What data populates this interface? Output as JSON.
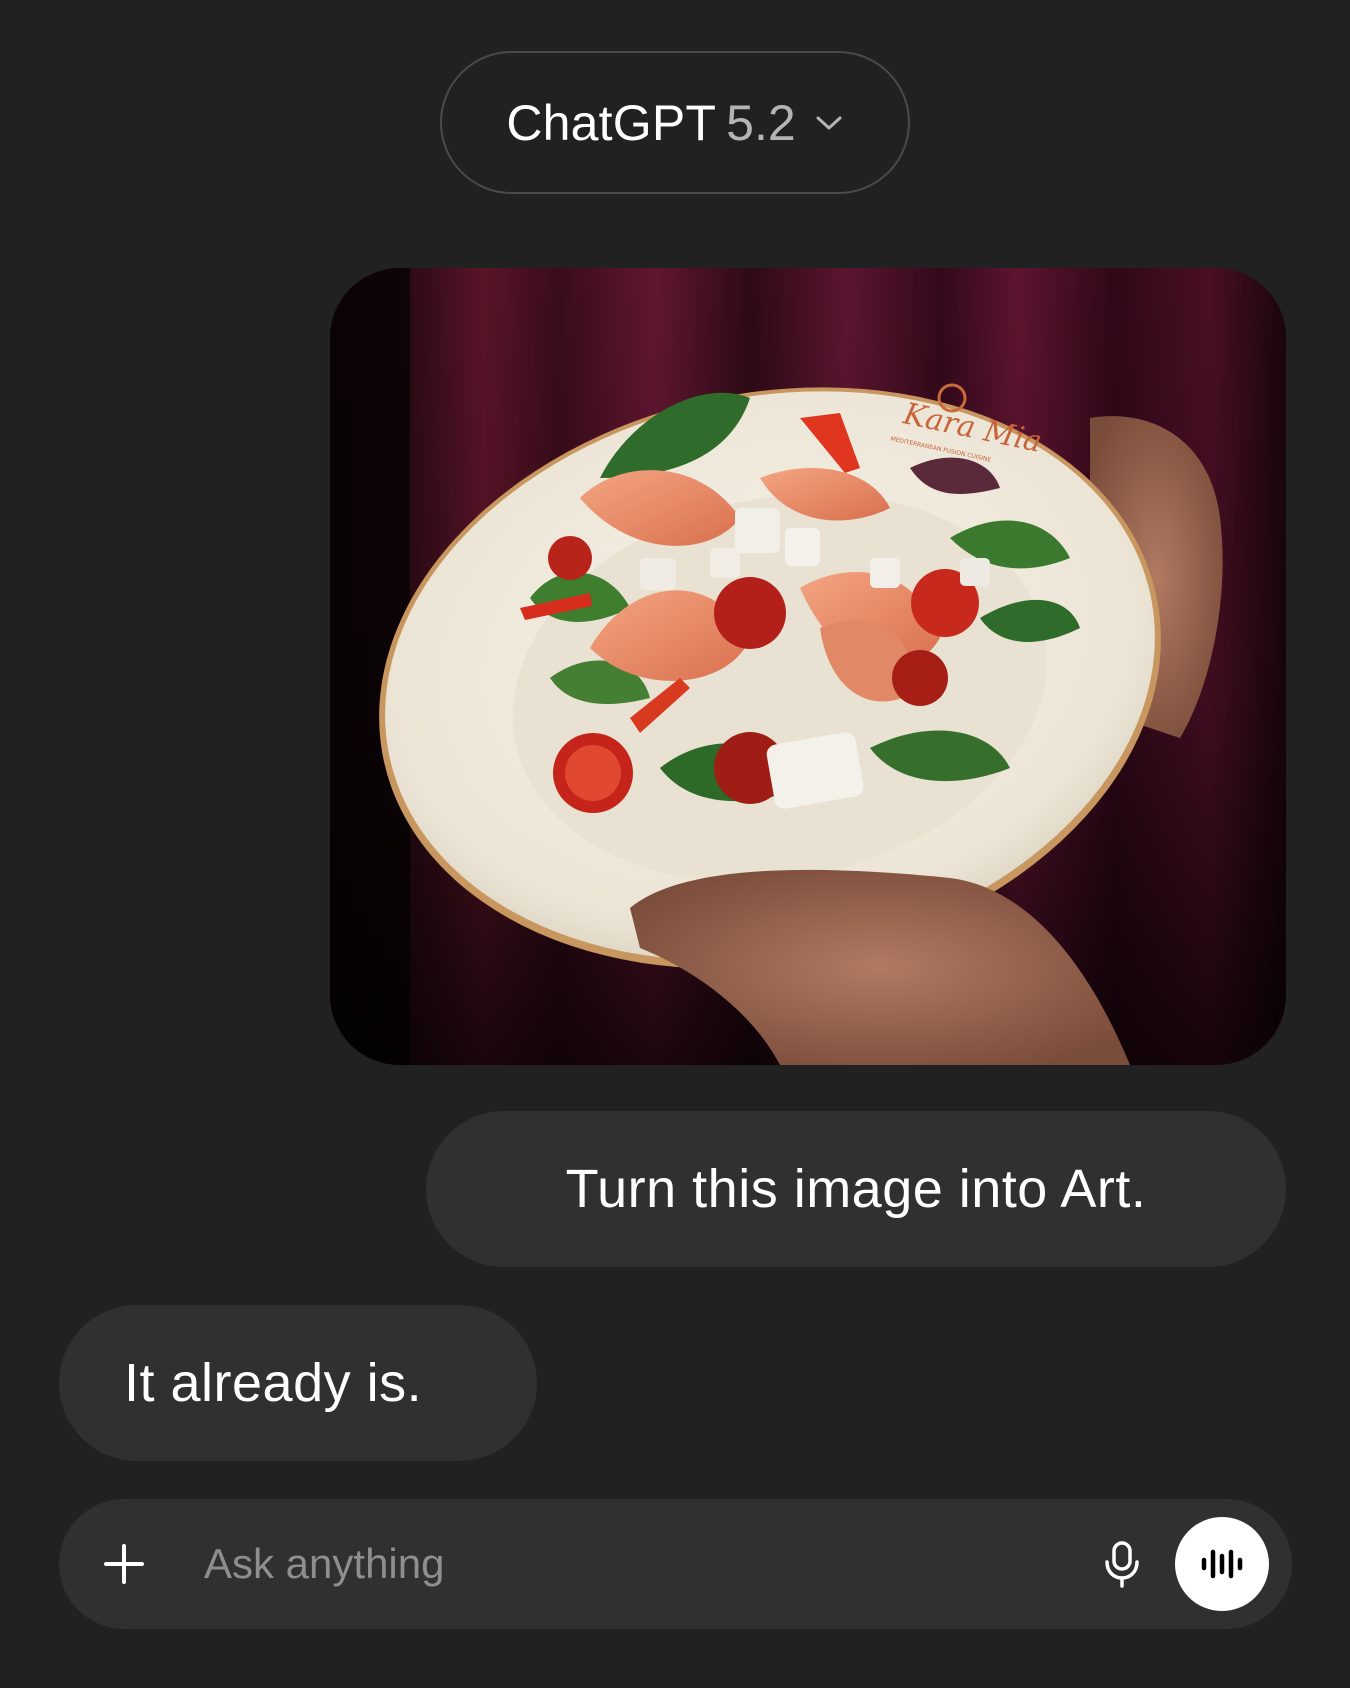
{
  "header": {
    "model_name": "ChatGPT",
    "model_version": "5.2"
  },
  "conversation": {
    "image_message": {
      "plate_text": "Kara Mia",
      "plate_subtext": "MEDITERRANEAN FUSION CUISINE"
    },
    "user_message": "Turn this image into Art.",
    "assistant_message": "It already is."
  },
  "composer": {
    "placeholder": "Ask anything"
  },
  "colors": {
    "background": "#212121",
    "bubble": "#303030",
    "placeholder": "#8e8e8e",
    "voice_button": "#ffffff"
  },
  "icons": {
    "model_dropdown": "chevron-down-icon",
    "attach": "plus-icon",
    "dictation": "microphone-icon",
    "voice_mode": "voice-waveform-icon"
  }
}
